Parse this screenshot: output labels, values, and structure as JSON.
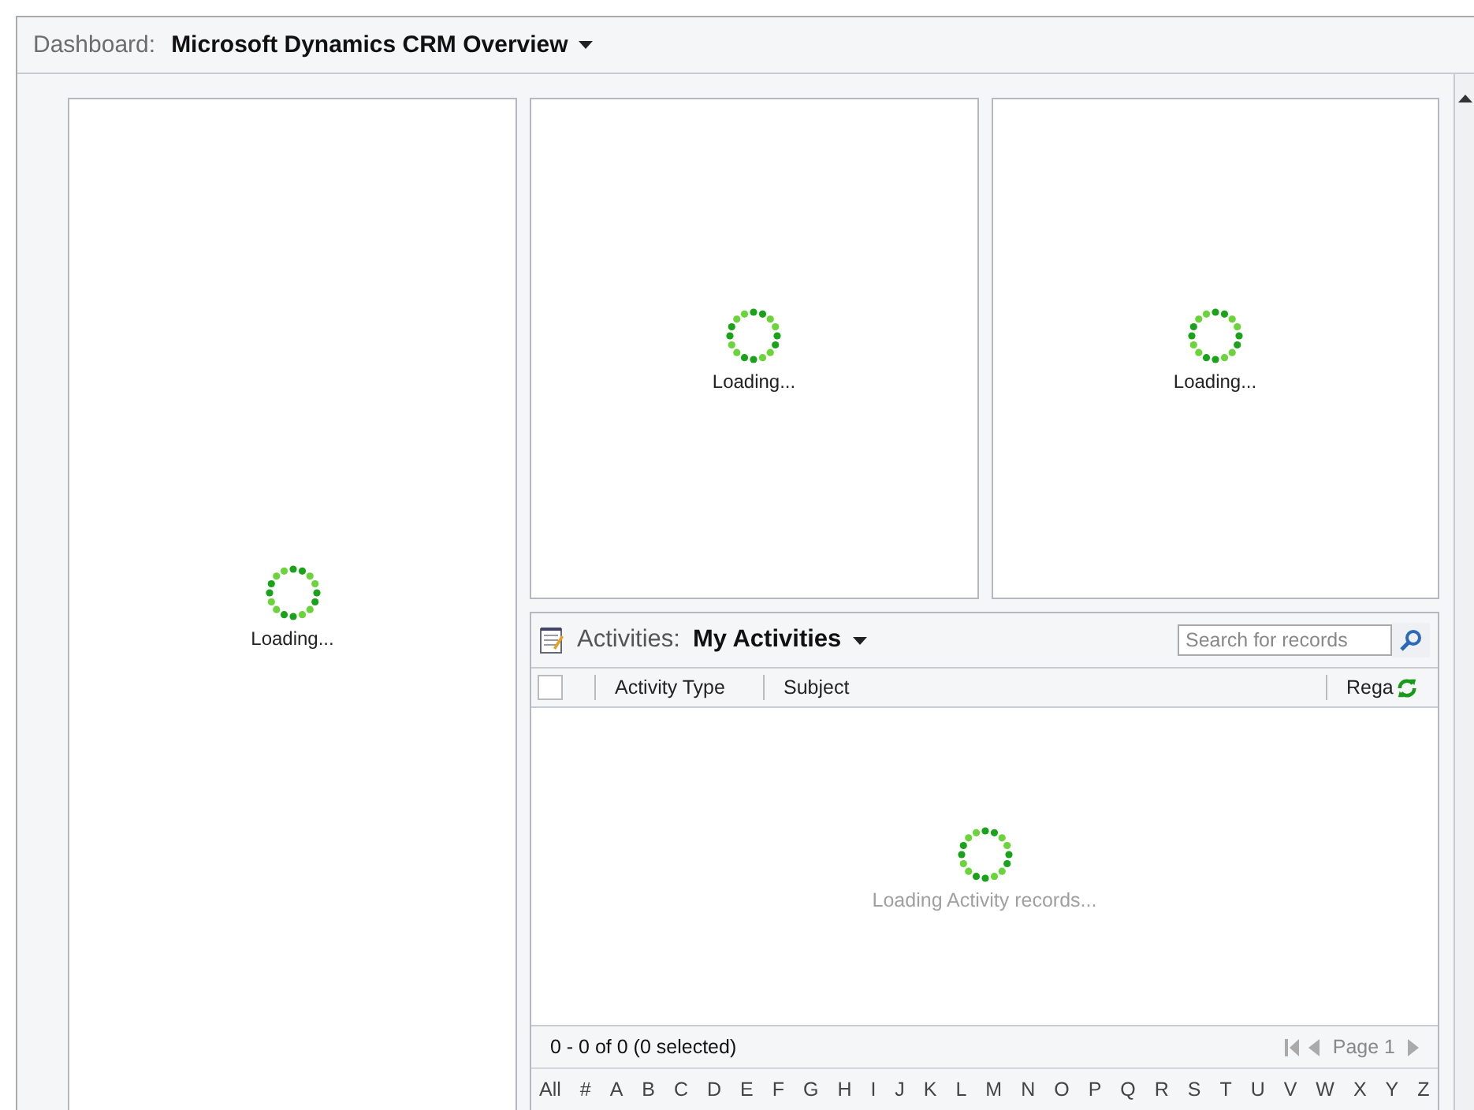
{
  "dashboard": {
    "label": "Dashboard:",
    "title": "Microsoft Dynamics CRM Overview"
  },
  "panels": [
    {
      "loading": "Loading..."
    },
    {
      "loading": "Loading..."
    },
    {
      "loading": "Loading..."
    }
  ],
  "activities": {
    "label": "Activities:",
    "view": "My Activities",
    "search": {
      "placeholder": "Search for records"
    },
    "select_all": {
      "checked": false
    },
    "columns": [
      "Activity Type",
      "Subject",
      "Rega"
    ],
    "loading": "Loading Activity records...",
    "status": "0 - 0 of 0 (0 selected)",
    "page": "Page 1",
    "letters": [
      "All",
      "#",
      "A",
      "B",
      "C",
      "D",
      "E",
      "F",
      "G",
      "H",
      "I",
      "J",
      "K",
      "L",
      "M",
      "N",
      "O",
      "P",
      "Q",
      "R",
      "S",
      "T",
      "U",
      "V",
      "W",
      "X",
      "Y",
      "Z"
    ]
  }
}
